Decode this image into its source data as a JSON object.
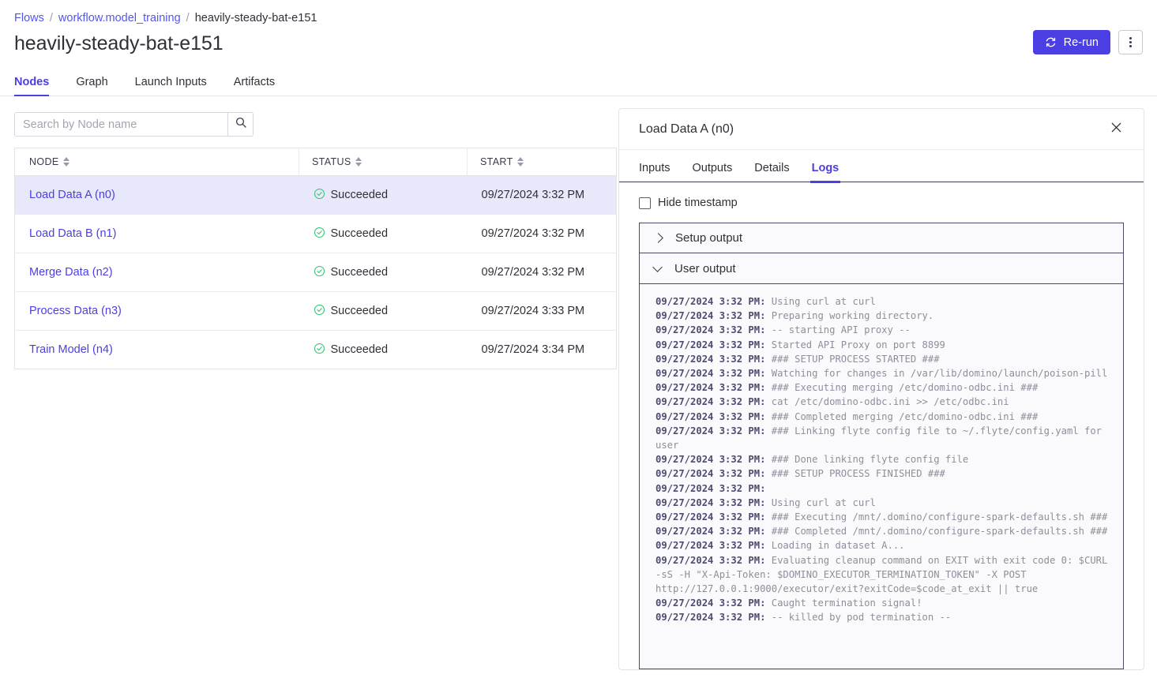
{
  "breadcrumb": {
    "items": [
      {
        "label": "Flows",
        "type": "link"
      },
      {
        "label": "workflow.model_training",
        "type": "link"
      },
      {
        "label": "heavily-steady-bat-e151",
        "type": "current"
      }
    ],
    "separator": "/"
  },
  "page_title": "heavily-steady-bat-e151",
  "actions": {
    "rerun_label": "Re-run",
    "rerun_icon": "refresh-icon",
    "more_icon": "kebab-menu-icon",
    "accent_color": "#4b3fe4"
  },
  "main_tabs": [
    {
      "label": "Nodes",
      "active": true
    },
    {
      "label": "Graph",
      "active": false
    },
    {
      "label": "Launch Inputs",
      "active": false
    },
    {
      "label": "Artifacts",
      "active": false
    }
  ],
  "search": {
    "placeholder": "Search by Node name",
    "value": "",
    "icon": "search-icon"
  },
  "table": {
    "columns": [
      {
        "label": "NODE",
        "sortable": true
      },
      {
        "label": "STATUS",
        "sortable": true
      },
      {
        "label": "START",
        "sortable": true
      }
    ],
    "rows": [
      {
        "node": "Load Data A (n0)",
        "status": "Succeeded",
        "start": "09/27/2024 3:32 PM",
        "selected": true
      },
      {
        "node": "Load Data B (n1)",
        "status": "Succeeded",
        "start": "09/27/2024 3:32 PM",
        "selected": false
      },
      {
        "node": "Merge Data (n2)",
        "status": "Succeeded",
        "start": "09/27/2024 3:32 PM",
        "selected": false
      },
      {
        "node": "Process Data (n3)",
        "status": "Succeeded",
        "start": "09/27/2024 3:33 PM",
        "selected": false
      },
      {
        "node": "Train Model (n4)",
        "status": "Succeeded",
        "start": "09/27/2024 3:34 PM",
        "selected": false
      }
    ],
    "status_color": "#3ec47a"
  },
  "panel": {
    "title": "Load Data A (n0)",
    "close_icon": "close-icon",
    "tabs": [
      {
        "label": "Inputs",
        "active": false
      },
      {
        "label": "Outputs",
        "active": false
      },
      {
        "label": "Details",
        "active": false
      },
      {
        "label": "Logs",
        "active": true
      }
    ],
    "hide_timestamp": {
      "label": "Hide timestamp",
      "checked": false
    },
    "accordions": [
      {
        "label": "Setup output",
        "expanded": false,
        "icon": "chevron-right-icon"
      },
      {
        "label": "User output",
        "expanded": true,
        "icon": "chevron-down-icon"
      }
    ],
    "logs": [
      {
        "ts": "09/27/2024 3:32 PM:",
        "msg": " Using curl at curl"
      },
      {
        "ts": "09/27/2024 3:32 PM:",
        "msg": " Preparing working directory."
      },
      {
        "ts": "09/27/2024 3:32 PM:",
        "msg": " -- starting API proxy --"
      },
      {
        "ts": "09/27/2024 3:32 PM:",
        "msg": " Started API Proxy on port 8899"
      },
      {
        "ts": "09/27/2024 3:32 PM:",
        "msg": " ### SETUP PROCESS STARTED ###"
      },
      {
        "ts": "09/27/2024 3:32 PM:",
        "msg": " Watching for changes in /var/lib/domino/launch/poison-pill"
      },
      {
        "ts": "09/27/2024 3:32 PM:",
        "msg": " ### Executing merging /etc/domino-odbc.ini ###"
      },
      {
        "ts": "09/27/2024 3:32 PM:",
        "msg": " cat /etc/domino-odbc.ini >> /etc/odbc.ini"
      },
      {
        "ts": "09/27/2024 3:32 PM:",
        "msg": " ### Completed merging /etc/domino-odbc.ini ###"
      },
      {
        "ts": "09/27/2024 3:32 PM:",
        "msg": " ### Linking flyte config file to ~/.flyte/config.yaml for user"
      },
      {
        "ts": "09/27/2024 3:32 PM:",
        "msg": " ### Done linking flyte config file"
      },
      {
        "ts": "09/27/2024 3:32 PM:",
        "msg": " ### SETUP PROCESS FINISHED ###"
      },
      {
        "ts": "09/27/2024 3:32 PM:",
        "msg": ""
      },
      {
        "ts": "09/27/2024 3:32 PM:",
        "msg": " Using curl at curl"
      },
      {
        "ts": "09/27/2024 3:32 PM:",
        "msg": " ### Executing /mnt/.domino/configure-spark-defaults.sh ###"
      },
      {
        "ts": "09/27/2024 3:32 PM:",
        "msg": " ### Completed /mnt/.domino/configure-spark-defaults.sh ###"
      },
      {
        "ts": "09/27/2024 3:32 PM:",
        "msg": " Loading in dataset A..."
      },
      {
        "ts": "09/27/2024 3:32 PM:",
        "msg": " Evaluating cleanup command on EXIT with exit code 0: $CURL -sS -H \"X-Api-Token: $DOMINO_EXECUTOR_TERMINATION_TOKEN\" -X POST http://127.0.0.1:9000/executor/exit?exitCode=$code_at_exit || true"
      },
      {
        "ts": "09/27/2024 3:32 PM:",
        "msg": " Caught termination signal!"
      },
      {
        "ts": "09/27/2024 3:32 PM:",
        "msg": " -- killed by pod termination --"
      }
    ]
  }
}
